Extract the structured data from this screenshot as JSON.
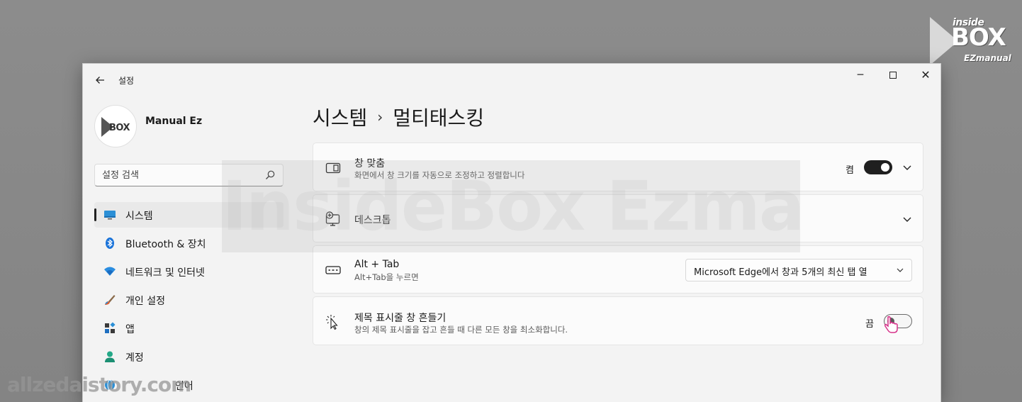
{
  "watermark": {
    "logo_line1": "inside",
    "logo_line2": "BOX",
    "logo_line3": "EZmanual",
    "center_text": "InsideBox Ezmanual",
    "bottom_text": "allzedaistory.com"
  },
  "window": {
    "app_title": "설정",
    "back_icon": "back-arrow-icon",
    "controls": {
      "minimize": "─",
      "close": "✕"
    }
  },
  "sidebar": {
    "profile_name": "Manual Ez",
    "avatar_text": "BOX",
    "search_placeholder": "설정 검색",
    "items": [
      {
        "label": "시스템",
        "icon": "monitor-icon",
        "selected": true
      },
      {
        "label": "Bluetooth & 장치",
        "icon": "bluetooth-icon",
        "selected": false
      },
      {
        "label": "네트워크 및 인터넷",
        "icon": "wifi-icon",
        "selected": false
      },
      {
        "label": "개인 설정",
        "icon": "brush-icon",
        "selected": false
      },
      {
        "label": "앱",
        "icon": "apps-icon",
        "selected": false
      },
      {
        "label": "계정",
        "icon": "account-icon",
        "selected": false
      },
      {
        "label": "언어",
        "icon": "language-icon",
        "selected": false
      }
    ]
  },
  "main": {
    "breadcrumb_parent": "시스템",
    "breadcrumb_sep": "›",
    "breadcrumb_current": "멀티태스킹",
    "cards": {
      "snap": {
        "title": "창 맞춤",
        "subtitle": "화면에서 창 크기를 자동으로 조정하고 정렬합니다",
        "state_label": "켬",
        "toggle_on": true
      },
      "desktops": {
        "title": "데스크톱"
      },
      "alttab": {
        "title": "Alt + Tab",
        "subtitle": "Alt+Tab을 누르면",
        "dropdown_value": "Microsoft Edge에서 창과 5개의 최신 탭 열"
      },
      "shake": {
        "title": "제목 표시줄 창 흔들기",
        "subtitle": "창의 제목 표시줄을 잡고 흔들 때 다른 모든 창을 최소화합니다.",
        "state_label": "끔",
        "toggle_on": false
      }
    }
  },
  "colors": {
    "accent_toggle_on": "#1f1f1f",
    "window_bg": "#f3f3f3",
    "card_bg": "#fbfbfb",
    "desktop_bg": "#8a8a8a",
    "cursor_pink": "#d6338a"
  }
}
